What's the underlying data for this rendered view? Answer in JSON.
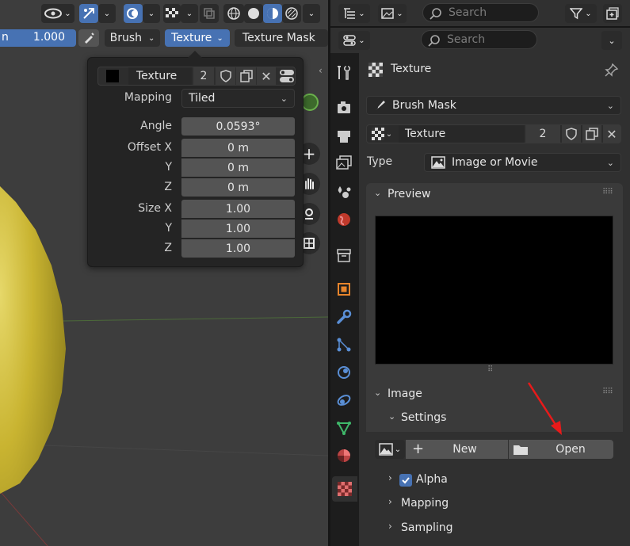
{
  "viewport": {
    "strength_value": "1.000",
    "brush_menu": "Brush",
    "texture_menu": "Texture",
    "texture_mask_menu": "Texture Mask"
  },
  "popover": {
    "texture_name": "Texture",
    "user_count": "2",
    "mapping_label": "Mapping",
    "mapping_value": "Tiled",
    "angle_label": "Angle",
    "angle_value": "0.0593°",
    "offset_x_label": "Offset X",
    "offset_x": "0 m",
    "offset_y_label": "Y",
    "offset_y": "0 m",
    "offset_z_label": "Z",
    "offset_z": "0 m",
    "size_x_label": "Size X",
    "size_x": "1.00",
    "size_y_label": "Y",
    "size_y": "1.00",
    "size_z_label": "Z",
    "size_z": "1.00"
  },
  "outliner": {
    "search_placeholder": "Search"
  },
  "properties": {
    "search_placeholder": "Search",
    "tab_title": "Texture",
    "texture_slot": "Brush Mask",
    "texture_name": "Texture",
    "user_count": "2",
    "type_label": "Type",
    "type_value": "Image or Movie",
    "preview_label": "Preview",
    "image_label": "Image",
    "settings_label": "Settings",
    "new_label": "New",
    "open_label": "Open",
    "alpha_label": "Alpha",
    "alpha_checked": true,
    "mapping_label": "Mapping",
    "sampling_label": "Sampling"
  },
  "colors": {
    "accent": "#4772b3",
    "panel": "#303030",
    "viewport": "#3d3d3d",
    "sphere": "#c9b431",
    "arrow": "#e81a1a"
  }
}
